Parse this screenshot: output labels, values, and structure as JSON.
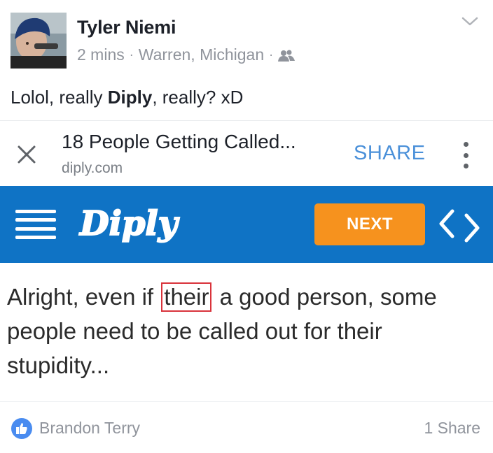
{
  "post": {
    "author": "Tyler Niemi",
    "time": "2 mins",
    "location": "Warren, Michigan",
    "separator": "·",
    "text_prefix": "Lolol, really ",
    "text_bold": "Diply",
    "text_suffix": ", really? xD"
  },
  "link_bar": {
    "title": "18 People Getting Called...",
    "domain": "diply.com",
    "share_label": "SHARE"
  },
  "diply_bar": {
    "logo_text": "Diply",
    "next_label": "NEXT"
  },
  "article": {
    "text_before": "Alright, even if ",
    "highlighted_word": "their",
    "text_after": " a good person, some people need to be called out for their stupidity..."
  },
  "footer": {
    "liker": "Brandon Terry",
    "shares": "1 Share"
  },
  "colors": {
    "diply_blue": "#0f73c5",
    "next_orange": "#f6921e",
    "share_blue": "#4a90d9",
    "like_blue": "#4a8cf0",
    "highlight_red": "#d9333b"
  },
  "icons": {
    "chevron": "chevron-down-icon",
    "friends": "friends-audience-icon",
    "close": "close-icon",
    "more": "more-vertical-icon",
    "hamburger": "menu-icon",
    "code": "code-brackets-icon",
    "like": "thumbs-up-icon"
  }
}
